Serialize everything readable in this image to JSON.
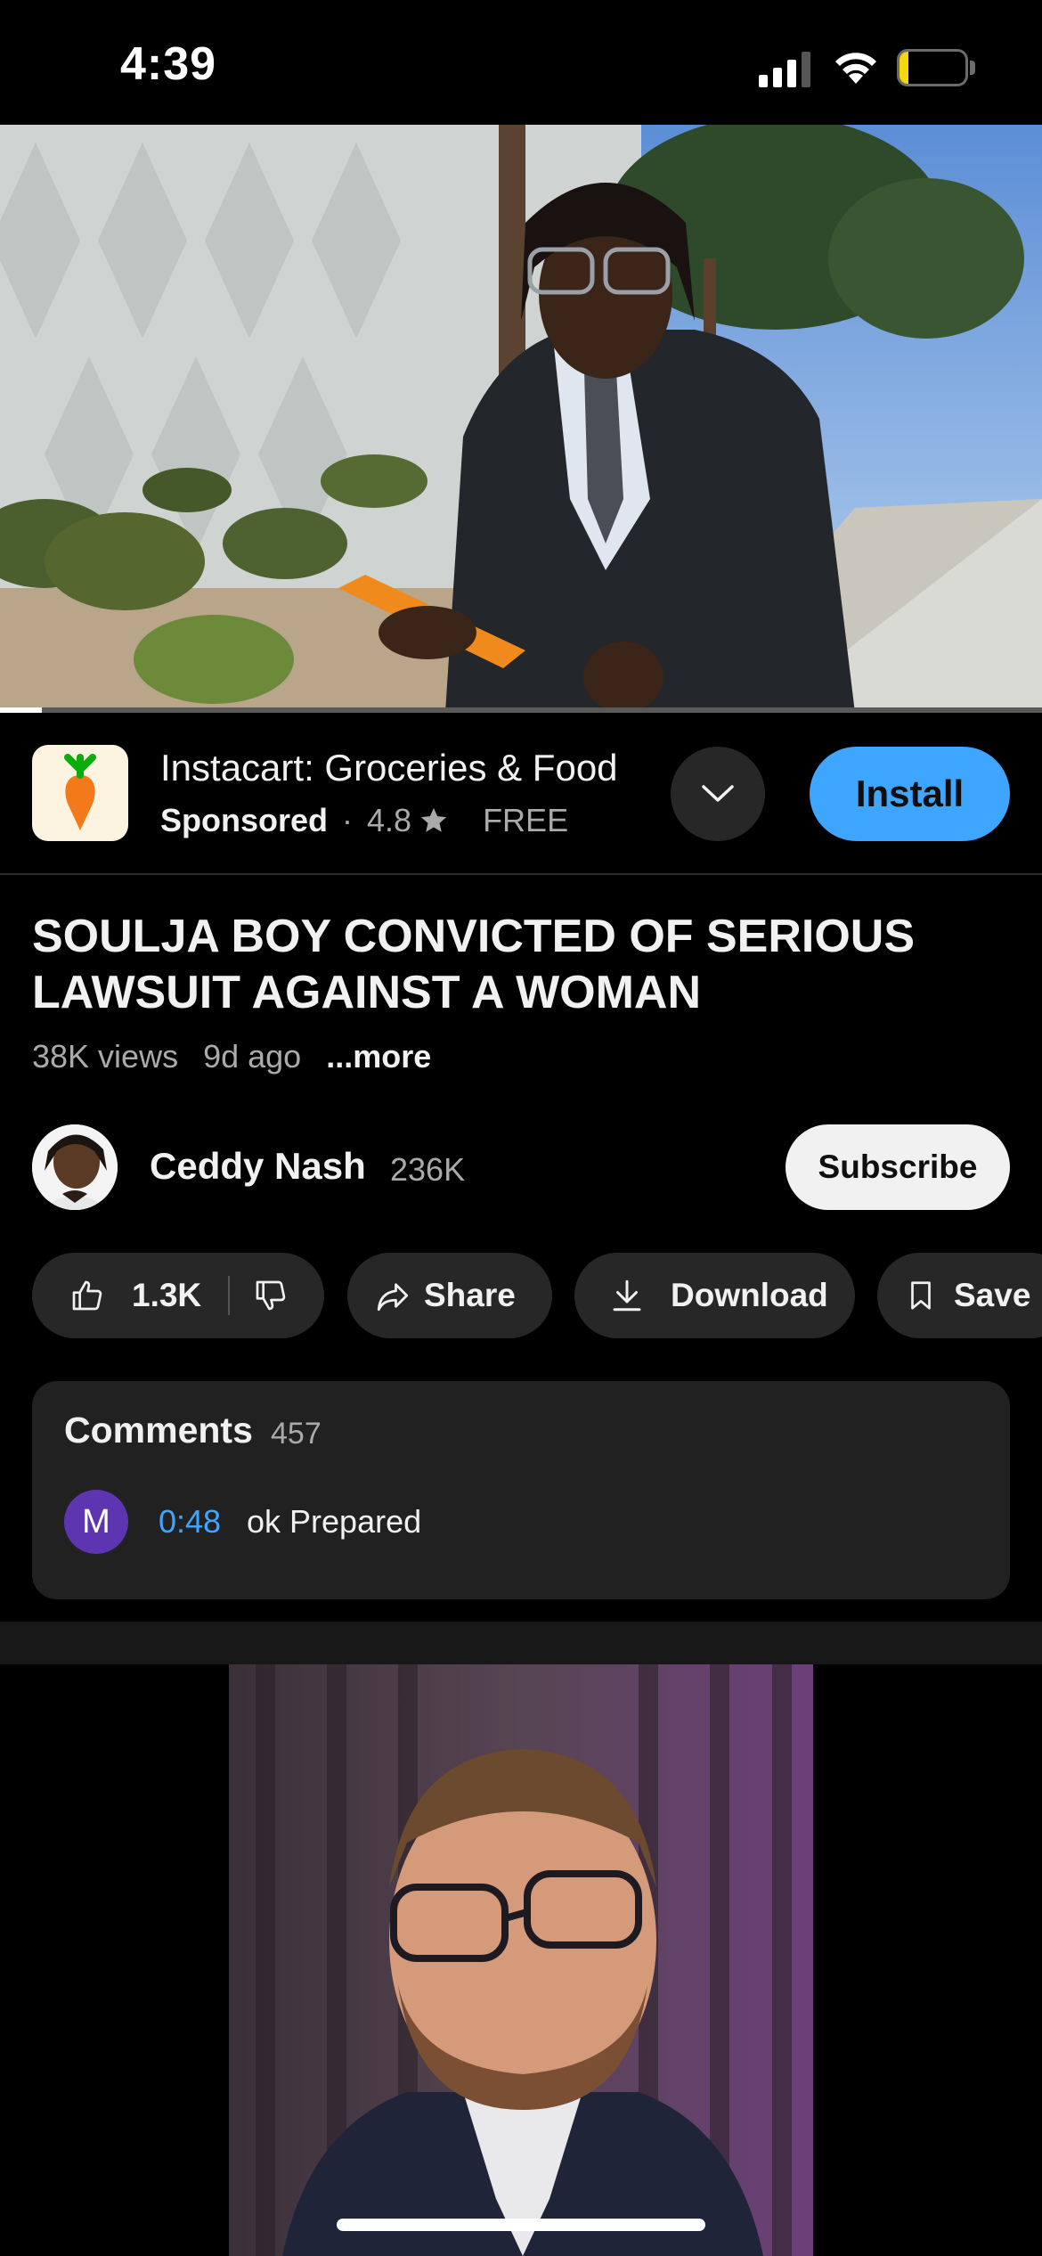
{
  "status_bar": {
    "time": "4:39",
    "battery": "13",
    "battery_level": 0.13
  },
  "player": {
    "progress": 0.04
  },
  "ad": {
    "title": "Instacart: Groceries & Food",
    "sponsored_label": "Sponsored",
    "separator": "·",
    "rating": "4.8",
    "price": "FREE",
    "install_label": "Install",
    "icon": "carrot-icon",
    "accent_color": "#3ea6ff"
  },
  "video": {
    "title": "SOULJA BOY CONVICTED OF SERIOUS LAWSUIT AGAINST A WOMAN",
    "views": "38K views",
    "age": "9d ago",
    "more_label": "...more"
  },
  "channel": {
    "name": "Ceddy Nash",
    "subscribers": "236K",
    "subscribe_label": "Subscribe"
  },
  "actions": {
    "likes": "1.3K",
    "share_label": "Share",
    "download_label": "Download",
    "save_label": "Save"
  },
  "comments": {
    "title": "Comments",
    "count": "457",
    "top_comment": {
      "avatar_letter": "M",
      "timestamp": "0:48",
      "text": "ok Prepared"
    }
  }
}
